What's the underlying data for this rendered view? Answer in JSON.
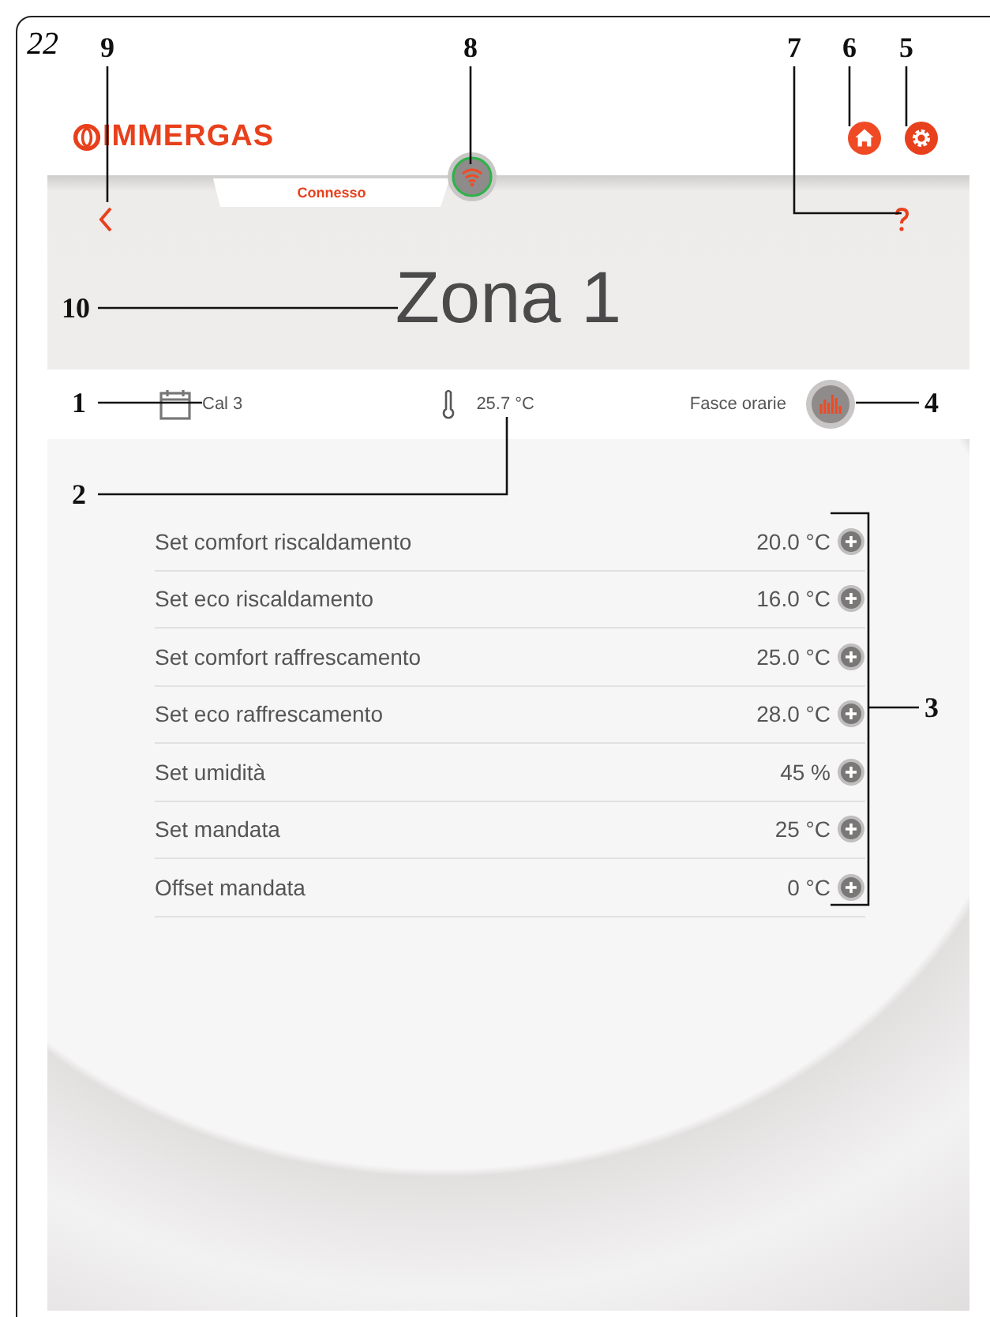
{
  "figure_number": "22",
  "callouts": [
    {
      "label": "9"
    },
    {
      "label": "8"
    },
    {
      "label": "7"
    },
    {
      "label": "6"
    },
    {
      "label": "5"
    },
    {
      "label": "10"
    },
    {
      "label": "1"
    },
    {
      "label": "4"
    },
    {
      "label": "2"
    },
    {
      "label": "3"
    }
  ],
  "header": {
    "logo": "IMMERGAS",
    "status_tab": "Connesso",
    "connected": true
  },
  "title": "Zona 1",
  "info_bar": {
    "calendar": "Cal 3",
    "temperature": "25.7 °C",
    "schedule": "Fasce orarie"
  },
  "settings": [
    {
      "label": "Set comfort riscaldamento",
      "value": "20.0 °C"
    },
    {
      "label": "Set eco riscaldamento",
      "value": "16.0 °C"
    },
    {
      "label": "Set comfort raffrescamento",
      "value": "25.0 °C"
    },
    {
      "label": "Set eco raffrescamento",
      "value": "28.0 °C"
    },
    {
      "label": "Set umidità",
      "value": "45 %"
    },
    {
      "label": "Set mandata",
      "value": "25 °C"
    },
    {
      "label": "Offset mandata",
      "value": "0 °C"
    }
  ]
}
